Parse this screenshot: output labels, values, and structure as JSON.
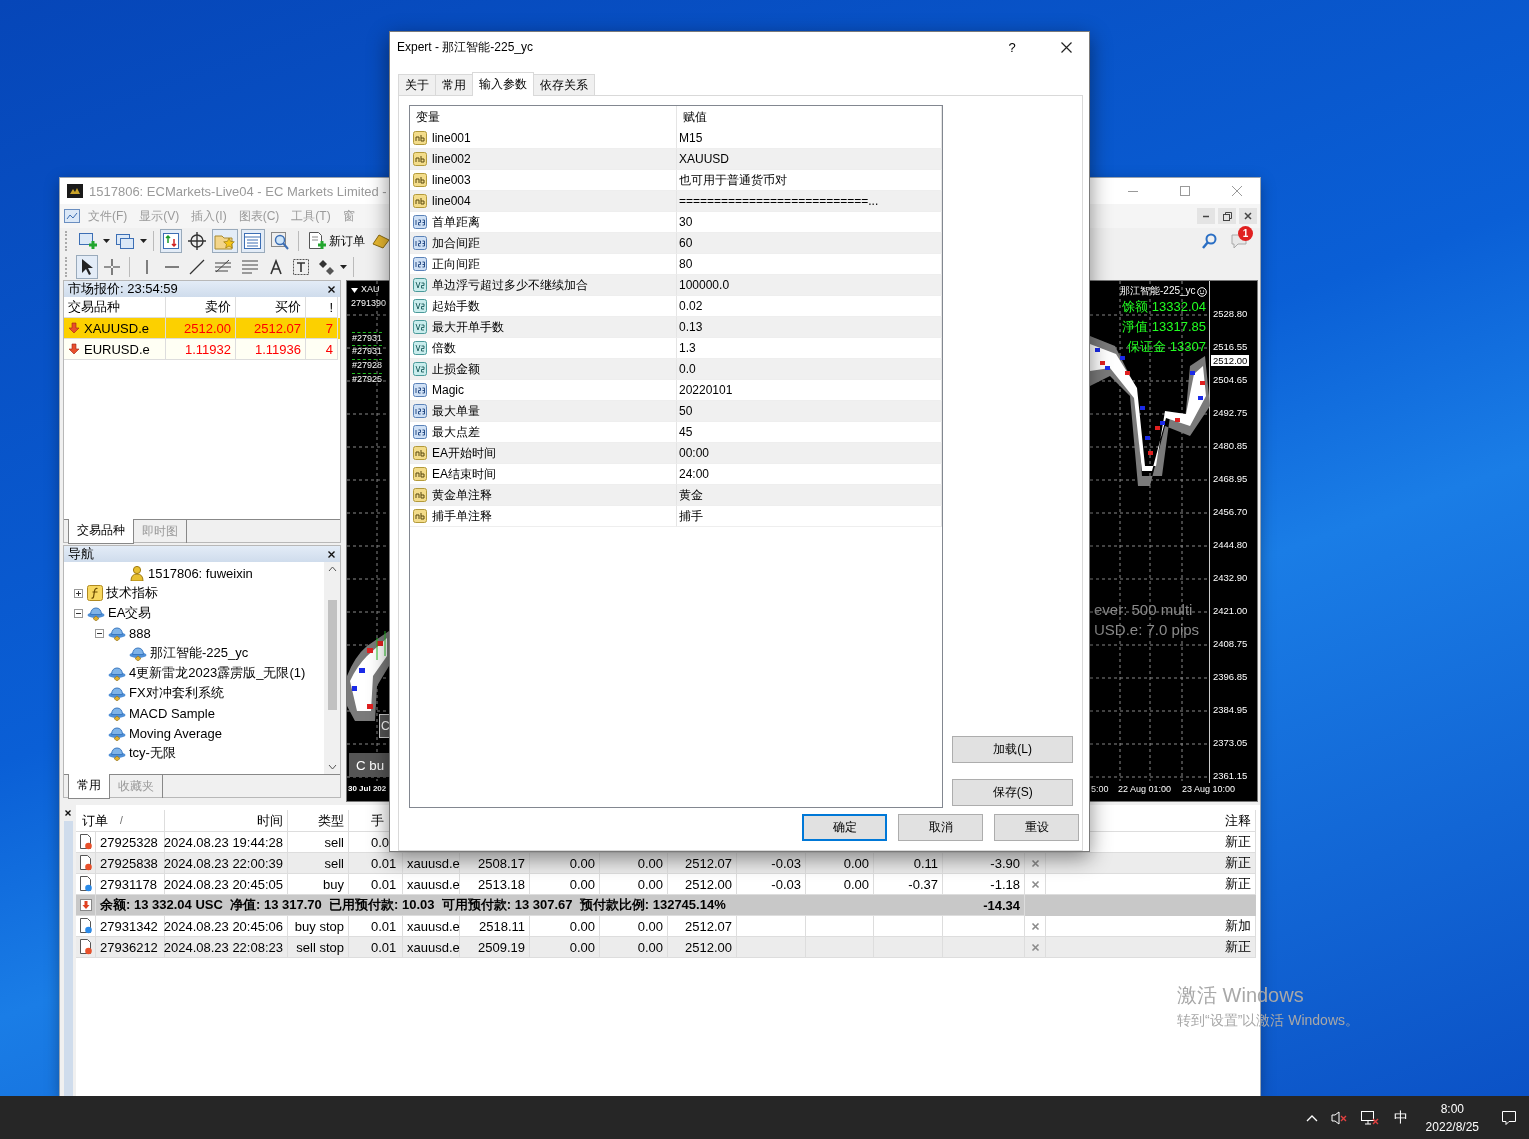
{
  "terminal_window": {
    "title": "1517806: ECMarkets-Live04 - EC Markets Limited -",
    "menu": [
      "文件(F)",
      "显示(V)",
      "插入(I)",
      "图表(C)",
      "工具(T)",
      "窗"
    ],
    "new_order_button": "新订单",
    "notification_count": "1",
    "market_watch": {
      "title": "市场报价: 23:54:59",
      "columns": [
        "交易品种",
        "卖价",
        "买价",
        "!"
      ],
      "rows": [
        {
          "symbol": "XAUUSD.e",
          "bid": "2512.00",
          "ask": "2512.07",
          "spread": "7",
          "selected": true
        },
        {
          "symbol": "EURUSD.e",
          "bid": "1.11932",
          "ask": "1.11936",
          "spread": "4",
          "selected": false
        }
      ],
      "tabs": [
        {
          "label": "交易品种",
          "selected": true
        },
        {
          "label": "即时图",
          "selected": false
        }
      ]
    },
    "navigator": {
      "title": "导航",
      "tree": [
        {
          "label": "1517806: fuweixin",
          "kind": "account"
        },
        {
          "label": "技术指标",
          "kind": "indicators",
          "expanded": false
        },
        {
          "label": "EA交易",
          "kind": "expert",
          "expanded": true,
          "children": [
            {
              "label": "888",
              "kind": "expert",
              "expanded": true,
              "children": [
                {
                  "label": "那江智能-225_yc",
                  "kind": "expert"
                }
              ]
            },
            {
              "label": "4更新雷龙2023霹雳版_无限(1)",
              "kind": "expert"
            },
            {
              "label": "FX对冲套利系统",
              "kind": "expert"
            },
            {
              "label": "MACD Sample",
              "kind": "expert"
            },
            {
              "label": "Moving Average",
              "kind": "expert"
            },
            {
              "label": "tcy-无限",
              "kind": "expert"
            }
          ]
        }
      ],
      "tabs": [
        {
          "label": "常用",
          "selected": true
        },
        {
          "label": "收藏夹",
          "selected": false
        }
      ]
    },
    "chart_left": {
      "symbol": "XAU",
      "labels": [
        "2791390",
        "#27931",
        "#27931",
        "#27928",
        "#27925"
      ],
      "small_button": "C",
      "button": "C bu",
      "date": "30 Jul 202"
    },
    "chart_right": {
      "ea_name": "那江智能-225_yc",
      "info": [
        "馀额 13332.04",
        "淨值 13317.85",
        "保证金 13307"
      ],
      "notes": [
        "ever: 500 multi",
        "USD.e: 7.0 pips"
      ],
      "price_ticks": [
        "2528.80",
        "2516.55",
        "2504.65",
        "2492.75",
        "2480.85",
        "2468.95",
        "2456.70",
        "2444.80",
        "2432.90",
        "2421.00",
        "2408.75",
        "2396.85",
        "2384.95",
        "2373.05",
        "2361.15"
      ],
      "current_price": "2512.00",
      "time_ticks": [
        "5:00",
        "22 Aug 01:00",
        "23 Aug 10:00"
      ]
    },
    "trade_table": {
      "columns": [
        "订单",
        "时间",
        "类型",
        "手",
        "注释"
      ],
      "sort_mark": "/",
      "rows": [
        {
          "kind": "sell",
          "order": "27925328",
          "time": "2024.08.23 19:44:28",
          "type": "sell",
          "lots": "0.0",
          "closable": false,
          "comment": "新正"
        },
        {
          "kind": "sell",
          "order": "27925838",
          "time": "2024.08.23 22:00:39",
          "type": "sell",
          "lots": "0.01",
          "symbol": "xauusd.e",
          "open_price": "2508.17",
          "sl": "0.00",
          "tp": "0.00",
          "price": "2512.07",
          "commission": "-0.03",
          "swap": "0.00",
          "tax": "0.11",
          "profit": "-3.90",
          "closable": true,
          "comment": "新正"
        },
        {
          "kind": "buy",
          "order": "27931178",
          "time": "2024.08.23 20:45:05",
          "type": "buy",
          "lots": "0.01",
          "symbol": "xauusd.e",
          "open_price": "2513.18",
          "sl": "0.00",
          "tp": "0.00",
          "price": "2512.00",
          "commission": "-0.03",
          "swap": "0.00",
          "tax": "-0.37",
          "profit": "-1.18",
          "closable": true,
          "comment": "新正"
        },
        {
          "kind": "summary",
          "text": "余额: 13 332.04 USC  净值: 13 317.70  已用预付款: 10.03  可用预付款: 13 307.67  预付款比例: 132745.14%",
          "profit": "-14.34"
        },
        {
          "kind": "buy",
          "order": "27931342",
          "time": "2024.08.23 20:45:06",
          "type": "buy stop",
          "lots": "0.01",
          "symbol": "xauusd.e",
          "open_price": "2518.11",
          "sl": "0.00",
          "tp": "0.00",
          "price": "2512.07",
          "closable": true,
          "comment": "新加"
        },
        {
          "kind": "sell",
          "order": "27936212",
          "time": "2024.08.23 22:08:23",
          "type": "sell stop",
          "lots": "0.01",
          "symbol": "xauusd.e",
          "open_price": "2509.19",
          "sl": "0.00",
          "tp": "0.00",
          "price": "2512.00",
          "closable": true,
          "comment": "新正"
        }
      ]
    }
  },
  "expert_dialog": {
    "title": "Expert - 那江智能-225_yc",
    "help": "?",
    "tabs": [
      {
        "label": "关于",
        "selected": false
      },
      {
        "label": "常用",
        "selected": false
      },
      {
        "label": "输入参数",
        "selected": true
      },
      {
        "label": "依存关系",
        "selected": false
      }
    ],
    "columns": [
      "变量",
      "赋值"
    ],
    "params": [
      {
        "kind": "string",
        "name": "line001",
        "value": "M15"
      },
      {
        "kind": "string",
        "name": "line002",
        "value": "XAUUSD"
      },
      {
        "kind": "string",
        "name": "line003",
        "value": "也可用于普通货币对"
      },
      {
        "kind": "string",
        "name": "line004",
        "value": "===========================..."
      },
      {
        "kind": "int",
        "name": "首单距离",
        "value": "30"
      },
      {
        "kind": "int",
        "name": "加合间距",
        "value": "60"
      },
      {
        "kind": "int",
        "name": "正向间距",
        "value": "80"
      },
      {
        "kind": "double",
        "name": "单边浮亏超过多少不继续加合",
        "value": "100000.0"
      },
      {
        "kind": "double",
        "name": "起始手数",
        "value": "0.02"
      },
      {
        "kind": "double",
        "name": "最大开单手数",
        "value": "0.13"
      },
      {
        "kind": "double",
        "name": "倍数",
        "value": "1.3"
      },
      {
        "kind": "double",
        "name": "止损金额",
        "value": "0.0"
      },
      {
        "kind": "int",
        "name": "Magic",
        "value": "20220101"
      },
      {
        "kind": "int",
        "name": "最大单量",
        "value": "50"
      },
      {
        "kind": "int",
        "name": "最大点差",
        "value": "45"
      },
      {
        "kind": "string",
        "name": "EA开始时间",
        "value": "00:00"
      },
      {
        "kind": "string",
        "name": "EA结束时间",
        "value": "24:00"
      },
      {
        "kind": "string",
        "name": "黄金单注释",
        "value": "黄金"
      },
      {
        "kind": "string",
        "name": "捕手单注释",
        "value": "捕手"
      }
    ],
    "side_buttons": [
      "加载(L)",
      "保存(S)"
    ],
    "buttons": [
      {
        "label": "确定",
        "default": true
      },
      {
        "label": "取消",
        "default": false
      },
      {
        "label": "重设",
        "default": false
      }
    ]
  },
  "activation_notice": {
    "title": "激活 Windows",
    "hint": "转到“设置”以激活 Windows。"
  },
  "taskbar": {
    "ime": "中",
    "time": "8:00",
    "date": "2022/8/25"
  }
}
